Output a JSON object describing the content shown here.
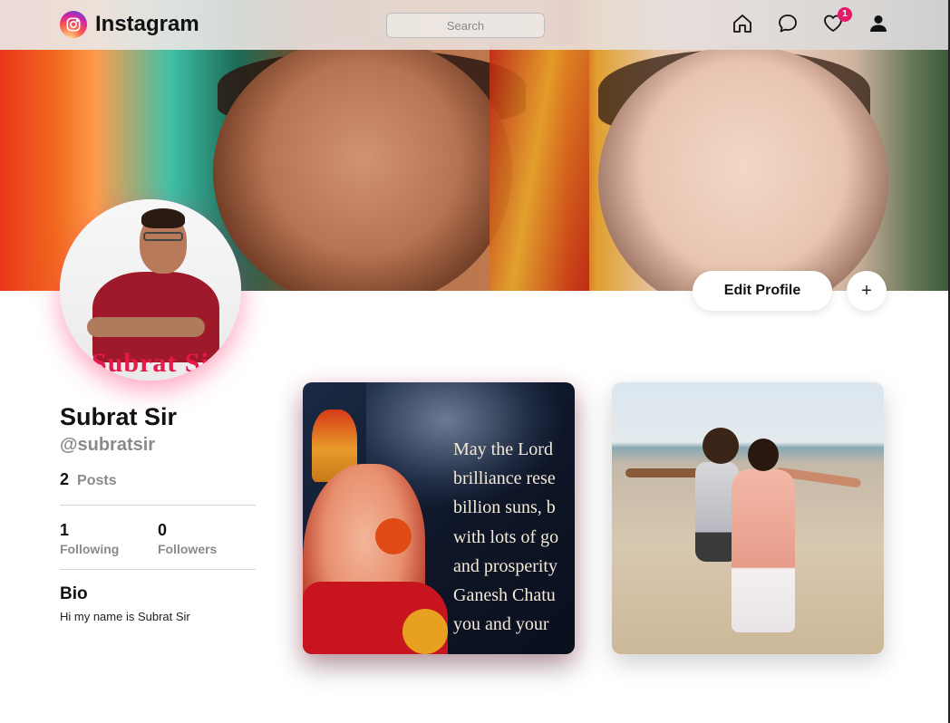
{
  "header": {
    "brand": "Instagram",
    "search_placeholder": "Search",
    "icons": [
      "home-icon",
      "chat-icon",
      "heart-icon",
      "user-icon"
    ],
    "notifications_count": "1"
  },
  "profile": {
    "name": "Subrat Sir",
    "handle": "@subratsir",
    "avatar_caption": "Subrat Si",
    "posts_count": "2",
    "posts_label": "Posts",
    "following_count": "1",
    "following_label": "Following",
    "followers_count": "0",
    "followers_label": "Followers",
    "bio_title": "Bio",
    "bio_text": "Hi my name is Subrat Sir"
  },
  "actions": {
    "edit_profile_label": "Edit Profile",
    "add_label": "+"
  },
  "posts": [
    {
      "image": "ganesh-greeting",
      "text_lines": [
        "May the Lord",
        "brilliance rese",
        "billion suns, b",
        "with lots of go",
        "and prosperity",
        "Ganesh Chatu",
        "you and your"
      ]
    },
    {
      "image": "beach-couple"
    }
  ],
  "colors": {
    "accent": "#e8196a",
    "muted_text": "#8a8a8a"
  }
}
